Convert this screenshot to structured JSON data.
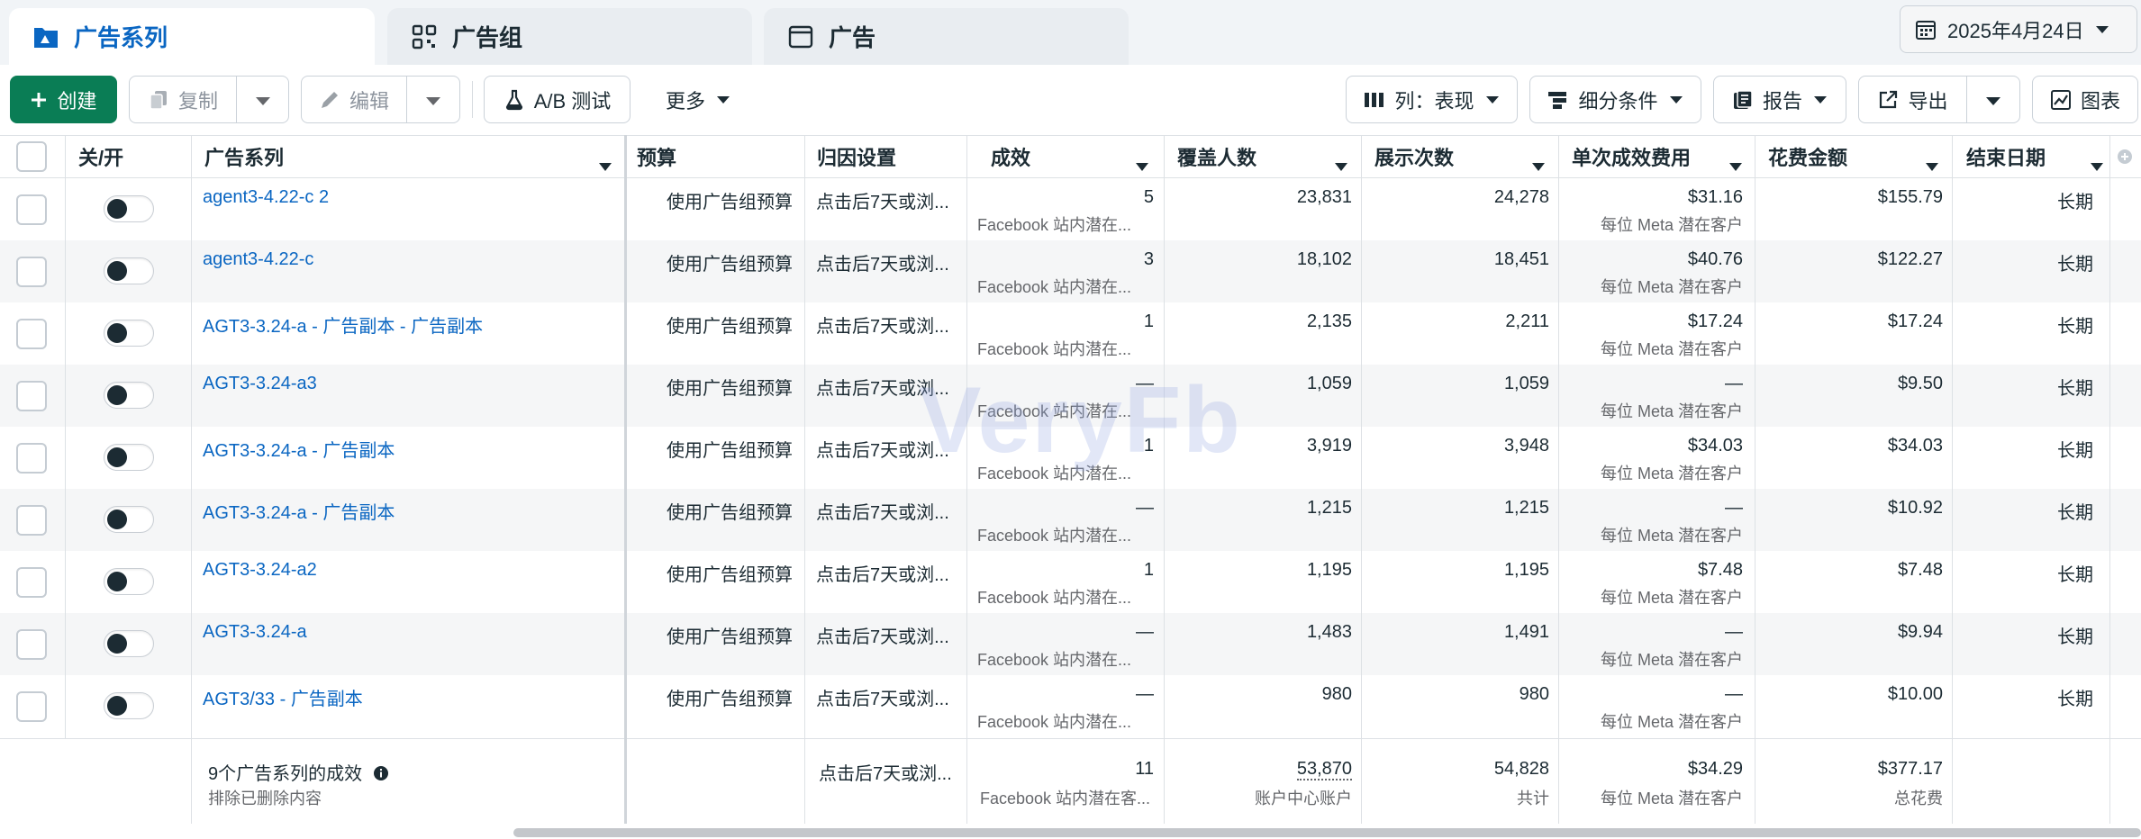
{
  "tabs": [
    {
      "label": "广告系列",
      "icon": "campaign-folder-icon",
      "active": true
    },
    {
      "label": "广告组",
      "icon": "ad-set-grid-icon",
      "active": false
    },
    {
      "label": "广告",
      "icon": "ad-window-icon",
      "active": false
    }
  ],
  "date_range": {
    "label": "2025年4月24日",
    "icon": "calendar-icon"
  },
  "toolbar": {
    "create": "创建",
    "duplicate": "复制",
    "edit": "编辑",
    "ab_test": "A/B 测试",
    "more": "更多",
    "columns": "列：表现",
    "breakdown": "细分条件",
    "reports": "报告",
    "export": "导出",
    "charts": "图表"
  },
  "columns": {
    "toggle": "关/开",
    "name": "广告系列",
    "budget": "预算",
    "attribution": "归因设置",
    "results": "成效",
    "reach": "覆盖人数",
    "impressions": "展示次数",
    "cost_per_result": "单次成效费用",
    "amount_spent": "花费金额",
    "end_date": "结束日期"
  },
  "rows": [
    {
      "name": "agent3-4.22-c 2",
      "budget": "使用广告组预算",
      "attribution": "点击后7天或浏...",
      "results": "5",
      "results_sub": "Facebook 站内潜在...",
      "reach": "23,831",
      "impressions": "24,278",
      "cpr": "$31.16",
      "cpr_sub": "每位 Meta 潜在客户",
      "spent": "$155.79",
      "end": "长期",
      "enabled": true
    },
    {
      "name": "agent3-4.22-c",
      "budget": "使用广告组预算",
      "attribution": "点击后7天或浏...",
      "results": "3",
      "results_sub": "Facebook 站内潜在...",
      "reach": "18,102",
      "impressions": "18,451",
      "cpr": "$40.76",
      "cpr_sub": "每位 Meta 潜在客户",
      "spent": "$122.27",
      "end": "长期",
      "enabled": true
    },
    {
      "name": "AGT3-3.24-a - 广告副本 - 广告副本",
      "budget": "使用广告组预算",
      "attribution": "点击后7天或浏...",
      "results": "1",
      "results_sub": "Facebook 站内潜在...",
      "reach": "2,135",
      "impressions": "2,211",
      "cpr": "$17.24",
      "cpr_sub": "每位 Meta 潜在客户",
      "spent": "$17.24",
      "end": "长期",
      "enabled": true
    },
    {
      "name": "AGT3-3.24-a3",
      "budget": "使用广告组预算",
      "attribution": "点击后7天或浏...",
      "results": "—",
      "results_sub": "Facebook 站内潜在...",
      "reach": "1,059",
      "impressions": "1,059",
      "cpr": "—",
      "cpr_sub": "每位 Meta 潜在客户",
      "spent": "$9.50",
      "end": "长期",
      "enabled": true
    },
    {
      "name": "AGT3-3.24-a - 广告副本",
      "budget": "使用广告组预算",
      "attribution": "点击后7天或浏...",
      "results": "1",
      "results_sub": "Facebook 站内潜在...",
      "reach": "3,919",
      "impressions": "3,948",
      "cpr": "$34.03",
      "cpr_sub": "每位 Meta 潜在客户",
      "spent": "$34.03",
      "end": "长期",
      "enabled": true
    },
    {
      "name": "AGT3-3.24-a - 广告副本",
      "budget": "使用广告组预算",
      "attribution": "点击后7天或浏...",
      "results": "—",
      "results_sub": "Facebook 站内潜在...",
      "reach": "1,215",
      "impressions": "1,215",
      "cpr": "—",
      "cpr_sub": "每位 Meta 潜在客户",
      "spent": "$10.92",
      "end": "长期",
      "enabled": true
    },
    {
      "name": "AGT3-3.24-a2",
      "budget": "使用广告组预算",
      "attribution": "点击后7天或浏...",
      "results": "1",
      "results_sub": "Facebook 站内潜在...",
      "reach": "1,195",
      "impressions": "1,195",
      "cpr": "$7.48",
      "cpr_sub": "每位 Meta 潜在客户",
      "spent": "$7.48",
      "end": "长期",
      "enabled": true
    },
    {
      "name": "AGT3-3.24-a",
      "budget": "使用广告组预算",
      "attribution": "点击后7天或浏...",
      "results": "—",
      "results_sub": "Facebook 站内潜在...",
      "reach": "1,483",
      "impressions": "1,491",
      "cpr": "—",
      "cpr_sub": "每位 Meta 潜在客户",
      "spent": "$9.94",
      "end": "长期",
      "enabled": true
    },
    {
      "name": "AGT3/33 - 广告副本",
      "budget": "使用广告组预算",
      "attribution": "点击后7天或浏...",
      "results": "—",
      "results_sub": "Facebook 站内潜在...",
      "reach": "980",
      "impressions": "980",
      "cpr": "—",
      "cpr_sub": "每位 Meta 潜在客户",
      "spent": "$10.00",
      "end": "长期",
      "enabled": true
    }
  ],
  "summary": {
    "title": "9个广告系列的成效",
    "subtitle": "排除已删除内容",
    "attribution": "点击后7天或浏...",
    "results": "11",
    "results_sub": "Facebook 站内潜在客...",
    "reach": "53,870",
    "reach_sub": "账户中心账户",
    "impressions": "54,828",
    "impressions_sub": "共计",
    "cpr": "$34.29",
    "cpr_sub": "每位 Meta 潜在客户",
    "spent": "$377.17",
    "spent_sub": "总花费"
  },
  "watermark": "VeryFb",
  "colors": {
    "accent": "#0a66c2",
    "primary_button": "#0a7d55",
    "zebra": "#f5f6f7"
  }
}
